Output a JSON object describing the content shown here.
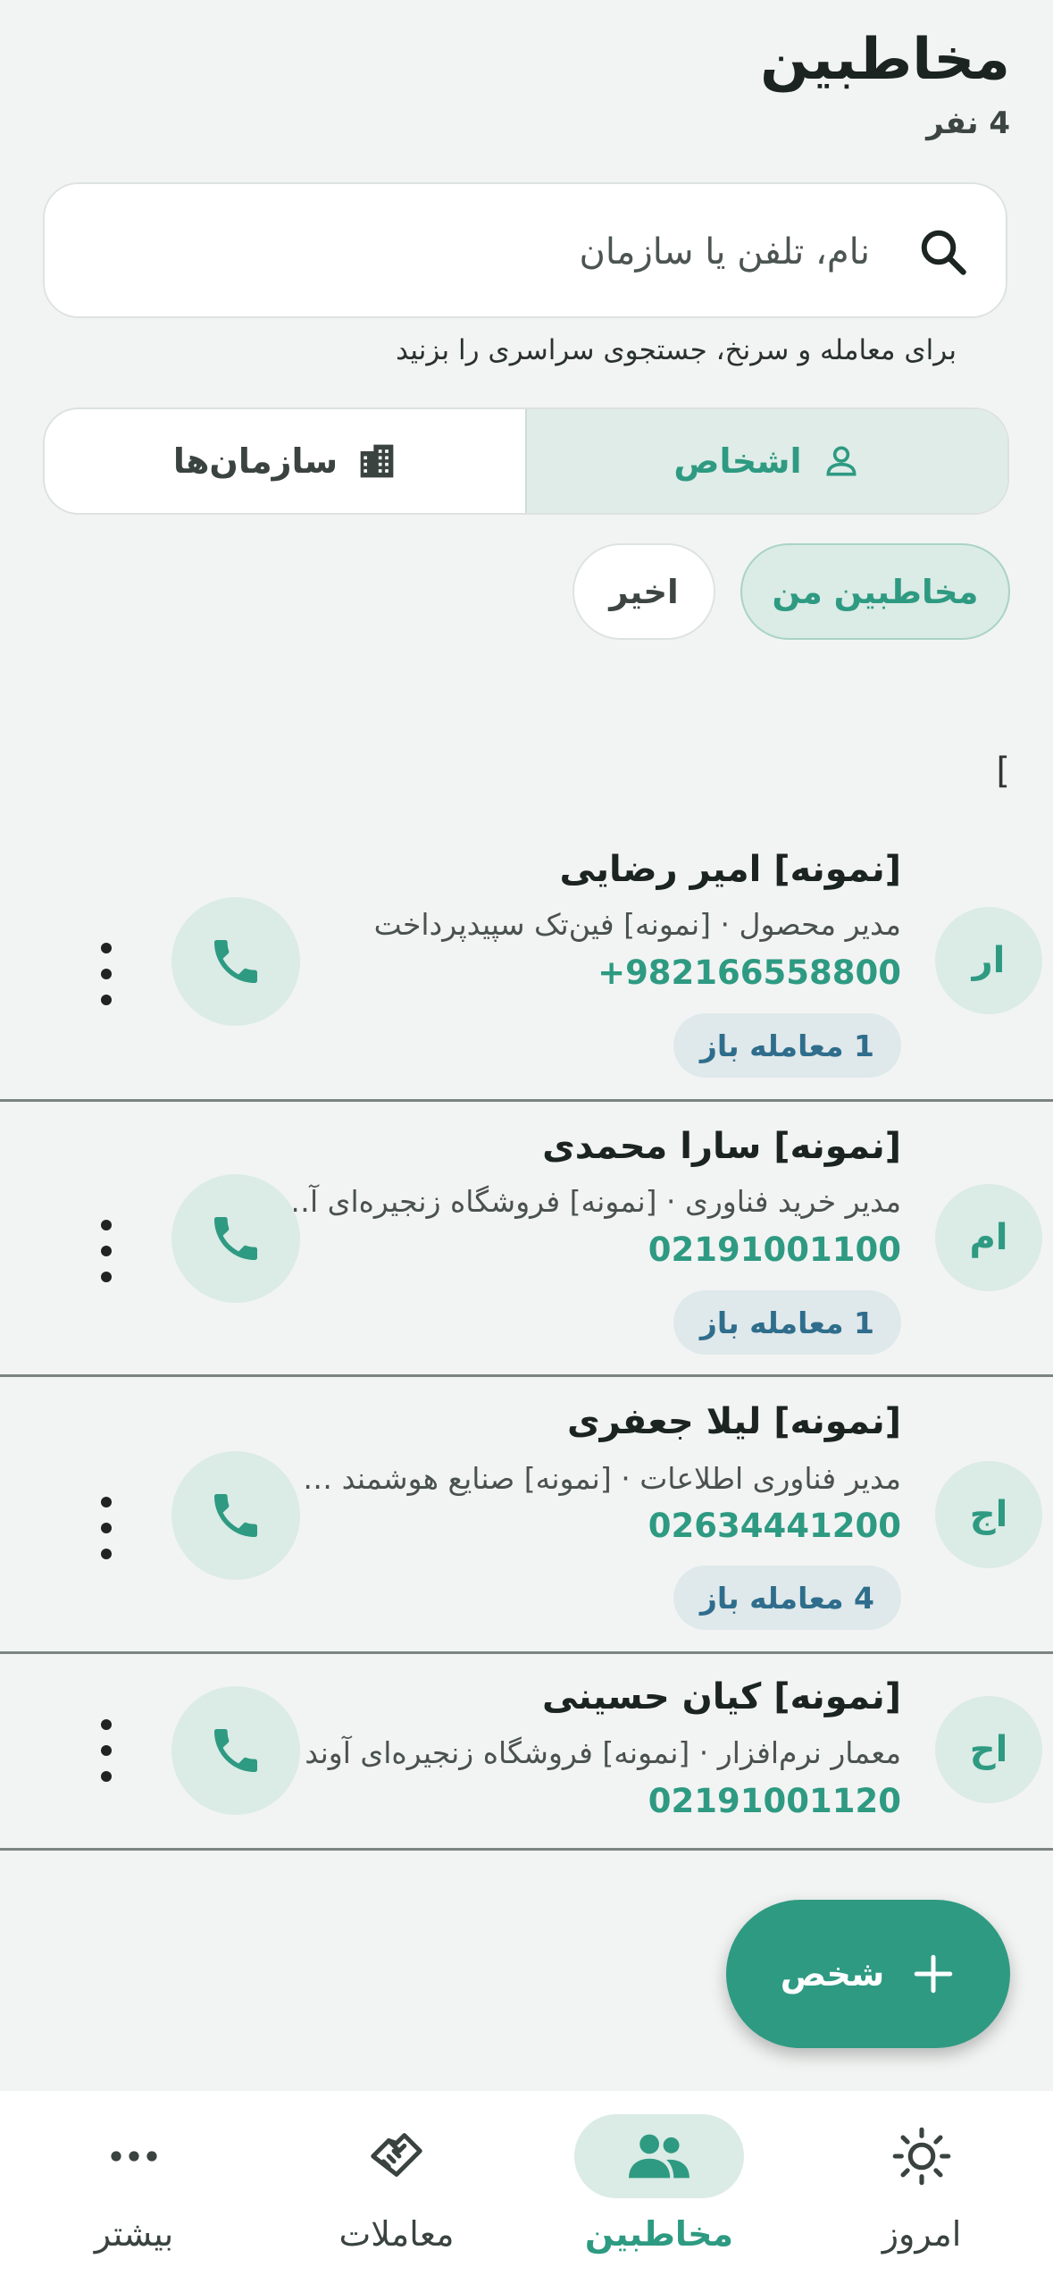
{
  "header": {
    "title": "مخاطبین",
    "count": "4 نفر"
  },
  "search": {
    "placeholder": "نام، تلفن یا سازمان",
    "value": "",
    "hint": "برای معامله و سرنخ، جستجوی سراسری را بزنید"
  },
  "segmented": {
    "people": "اشخاص",
    "orgs": "سازمان‌ها",
    "selected": "people"
  },
  "chips": {
    "mine": "مخاطبین من",
    "recent": "اخیر",
    "selected": "mine"
  },
  "stray_text": "[",
  "contacts": [
    {
      "initials": "ار",
      "name": "[نمونه] امیر رضایی",
      "subtitle": "مدیر محصول · [نمونه] فین‌تک سپیدپرداخت",
      "phone": "+982166558800",
      "deals": "1 معامله باز"
    },
    {
      "initials": "ام",
      "name": "[نمونه] سارا محمدی",
      "subtitle": "مدیر خرید فناوری · [نمونه] فروشگاه زنجیره‌ای آ…",
      "phone": "02191001100",
      "deals": "1 معامله باز"
    },
    {
      "initials": "اج",
      "name": "[نمونه] لیلا جعفری",
      "subtitle": "مدیر فناوری اطلاعات · [نمونه] صنایع هوشمند …",
      "phone": "02634441200",
      "deals": "4 معامله باز"
    },
    {
      "initials": "اح",
      "name": "[نمونه] کیان حسینی",
      "subtitle": "معمار نرم‌افزار · [نمونه] فروشگاه زنجیره‌ای آوند",
      "phone": "02191001120",
      "deals": ""
    }
  ],
  "fab": {
    "label": "شخص"
  },
  "nav": {
    "today": "امروز",
    "contacts": "مخاطبین",
    "deals": "معاملات",
    "more": "بیشتر",
    "active": "contacts"
  },
  "colors": {
    "accent": "#2e9a82",
    "accent_light": "#dbebe6",
    "background": "#f2f4f3",
    "deal_badge_text": "#2f6d8c"
  },
  "icons": {
    "search": "search-icon",
    "person": "person-icon",
    "building": "building-icon",
    "phone": "phone-icon",
    "more": "more-vertical-icon",
    "plus": "plus-icon",
    "sun": "sun-icon",
    "people": "people-icon",
    "handshake": "handshake-icon",
    "dots": "more-horizontal-icon"
  }
}
